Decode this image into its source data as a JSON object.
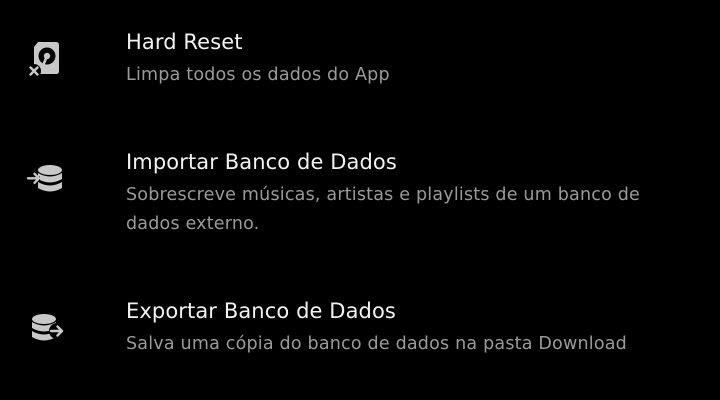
{
  "settings": {
    "items": [
      {
        "title": "Hard Reset",
        "description": "Limpa todos os dados do App",
        "icon": "sd-card-reset-icon"
      },
      {
        "title": "Importar Banco de Dados",
        "description": "Sobrescreve músicas, artistas e playlists de um banco de dados externo.",
        "icon": "database-import-icon"
      },
      {
        "title": "Exportar Banco de Dados",
        "description": "Salva uma cópia do banco de dados na pasta Download",
        "icon": "database-export-icon"
      }
    ]
  },
  "colors": {
    "background": "#000000",
    "title": "#f2f2f2",
    "description": "#9a9a9a",
    "icon": "#c8c8c8"
  }
}
